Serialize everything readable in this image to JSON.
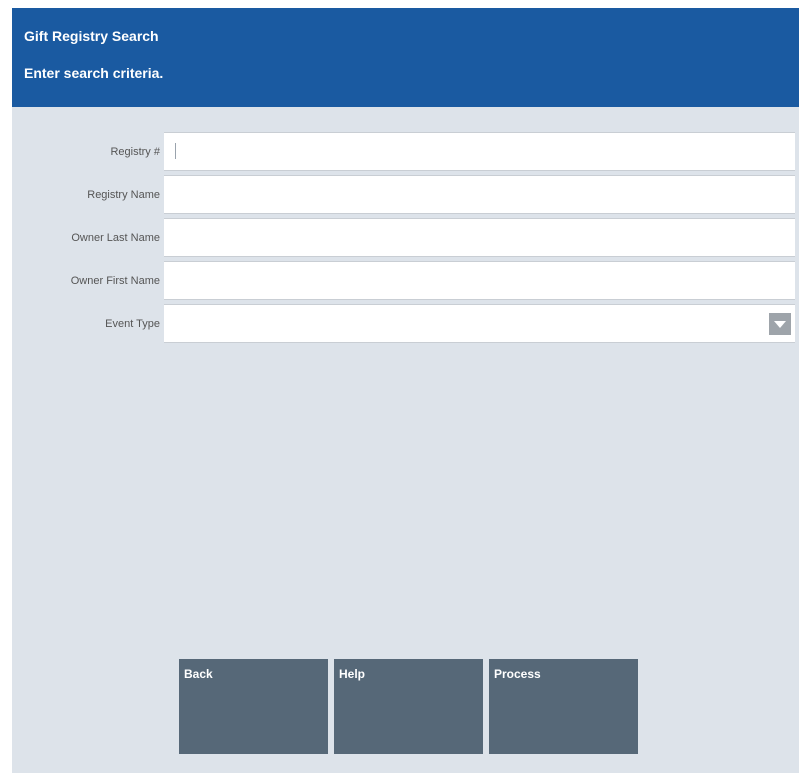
{
  "header": {
    "title": "Gift Registry Search",
    "subtitle": "Enter search criteria."
  },
  "form": {
    "fields": [
      {
        "label": "Registry #",
        "value": ""
      },
      {
        "label": "Registry Name",
        "value": ""
      },
      {
        "label": "Owner Last Name",
        "value": ""
      },
      {
        "label": "Owner First Name",
        "value": ""
      },
      {
        "label": "Event Type",
        "value": "",
        "type": "select"
      }
    ]
  },
  "buttons": {
    "back": "Back",
    "help": "Help",
    "process": "Process"
  },
  "colors": {
    "header_bg": "#1a5aa1",
    "panel_bg": "#dde3ea",
    "button_bg": "#566878"
  },
  "icons": {
    "dropdown": "chevron-down-icon"
  }
}
